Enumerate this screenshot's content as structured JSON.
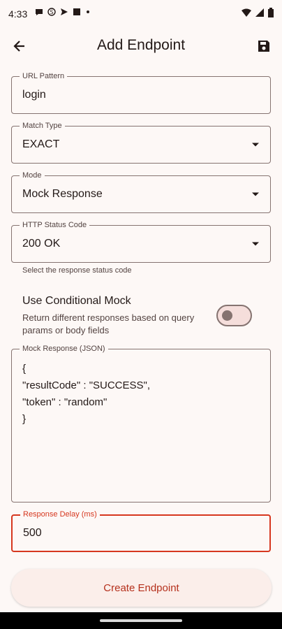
{
  "status_bar": {
    "time": "4:33",
    "left_icons": [
      "chat-bubble-icon",
      "s-icon",
      "send-icon",
      "square-icon",
      "dot-icon"
    ],
    "right_icons": [
      "wifi-icon",
      "signal-icon",
      "battery-icon"
    ]
  },
  "app_bar": {
    "title": "Add Endpoint",
    "back_icon": "arrow-back-icon",
    "save_icon": "save-icon"
  },
  "form": {
    "url_pattern": {
      "label": "URL Pattern",
      "value": "login"
    },
    "match_type": {
      "label": "Match Type",
      "value": "EXACT"
    },
    "mode": {
      "label": "Mode",
      "value": "Mock Response"
    },
    "status_code": {
      "label": "HTTP Status Code",
      "value": "200 OK",
      "helper": "Select the response status code"
    },
    "conditional": {
      "title": "Use Conditional Mock",
      "description": "Return different responses based on query params or body fields",
      "enabled": false
    },
    "mock_response": {
      "label": "Mock Response (JSON)",
      "value": "{\n\"resultCode\" : \"SUCCESS\",\n\"token\" : \"random\"\n}"
    },
    "response_delay": {
      "label": "Response Delay (ms)",
      "value": "500"
    }
  },
  "create_button": {
    "label": "Create Endpoint"
  },
  "colors": {
    "accent": "#d6371f",
    "background": "#fdf8f6",
    "outline": "#857370"
  }
}
